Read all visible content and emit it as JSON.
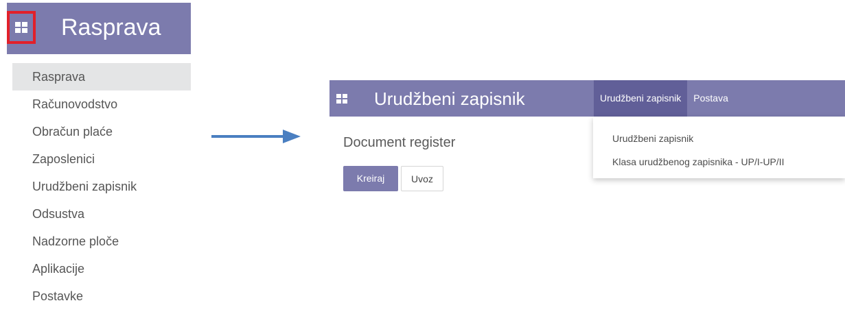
{
  "left_panel": {
    "title": "Rasprava",
    "menu_items": [
      "Rasprava",
      "Računovodstvo",
      "Obračun plaće",
      "Zaposlenici",
      "Urudžbeni zapisnik",
      "Odsustva",
      "Nadzorne ploče",
      "Aplikacije",
      "Postavke"
    ],
    "active_item": "Rasprava"
  },
  "right_panel": {
    "app_title": "Urudžbeni zapisnik",
    "top_menu": [
      "Urudžbeni zapisnik",
      "Postava"
    ],
    "dropdown_items": [
      "Urudžbeni zapisnik",
      "Klasa urudžbenog zapisnika - UP/I-UP/II"
    ],
    "page_heading": "Document register",
    "buttons": {
      "create": "Kreiraj",
      "import": "Uvoz"
    }
  },
  "colors": {
    "header": "#7c7bad",
    "active_menu": "#615f98",
    "highlight_border": "#e2202a",
    "arrow": "#4a7fc1",
    "active_row": "#e4e5e6"
  },
  "icons": {
    "apps": "grid-icon",
    "arrow": "arrow-right-icon"
  }
}
